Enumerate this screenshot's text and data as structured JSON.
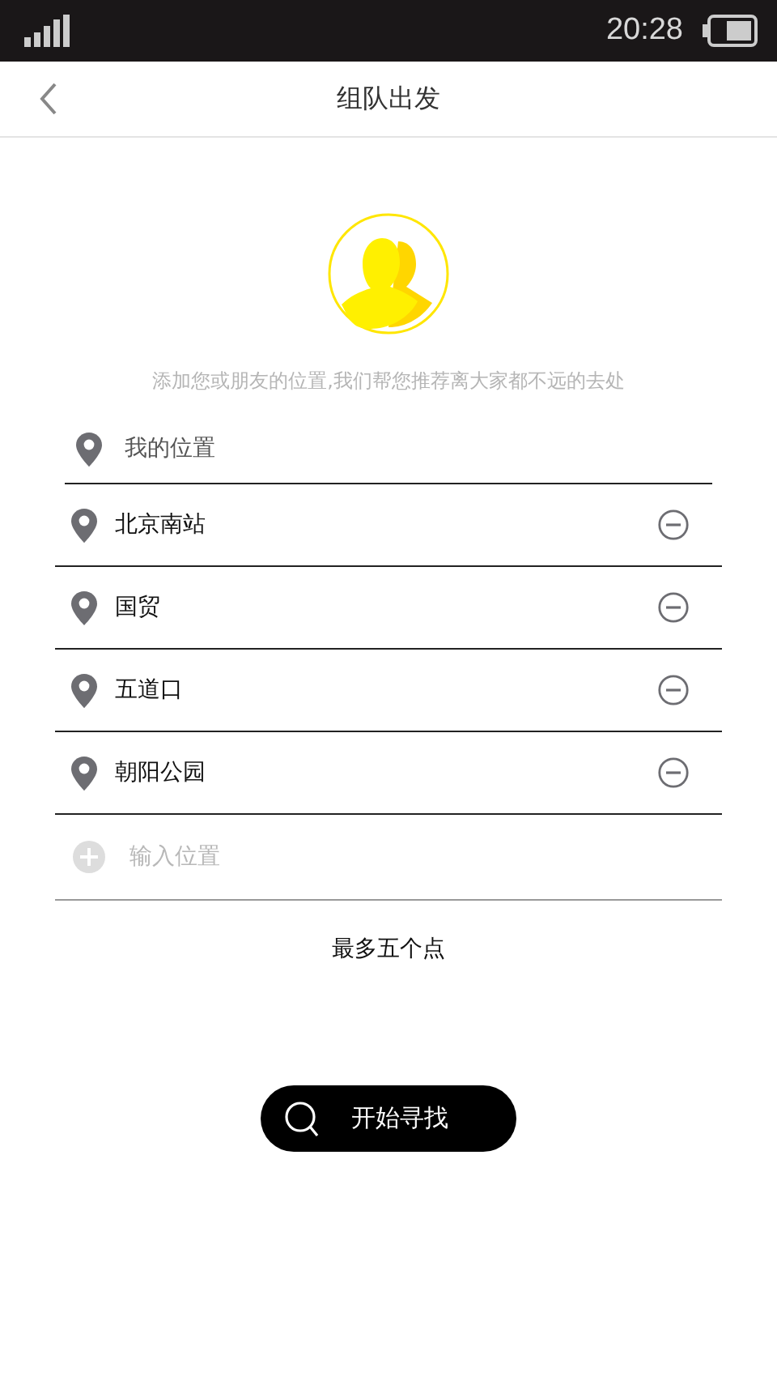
{
  "status_bar": {
    "time": "20:28"
  },
  "nav": {
    "title": "组队出发"
  },
  "hint": "添加您或朋友的位置,我们帮您推荐离大家都不远的去处",
  "my_location": {
    "label": "我的位置"
  },
  "locations": [
    {
      "name": "北京南站"
    },
    {
      "name": "国贸"
    },
    {
      "name": "五道口"
    },
    {
      "name": "朝阳公园"
    }
  ],
  "add_field": {
    "placeholder": "输入位置"
  },
  "limit_note": "最多五个点",
  "search_button": {
    "label": "开始寻找"
  }
}
